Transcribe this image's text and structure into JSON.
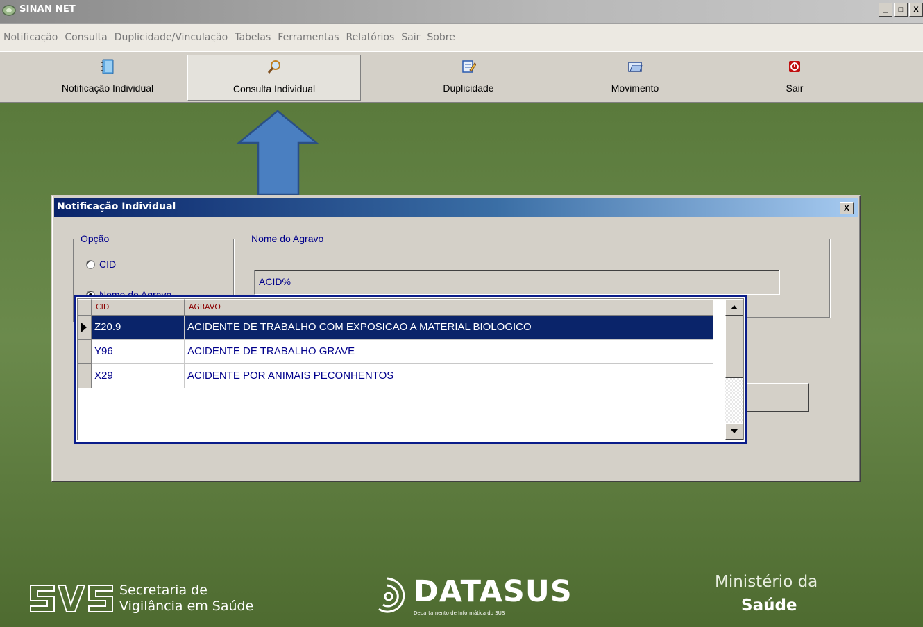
{
  "window": {
    "title": "SINAN NET",
    "controls": [
      "_",
      "□",
      "X"
    ]
  },
  "menu": {
    "items": [
      "Notificação",
      "Consulta",
      "Duplicidade/Vinculação",
      "Tabelas",
      "Ferramentas",
      "Relatórios",
      "Sair",
      "Sobre"
    ]
  },
  "toolbar": {
    "buttons": [
      {
        "label": "Notificação Individual",
        "icon": "notebook-icon"
      },
      {
        "label": "Consulta Individual",
        "icon": "magnifier-icon",
        "active": true
      },
      {
        "label": "Duplicidade",
        "icon": "duplicate-edit-icon"
      },
      {
        "label": "Movimento",
        "icon": "folder-icon"
      },
      {
        "label": "Sair",
        "icon": "power-icon"
      }
    ]
  },
  "dialog": {
    "title": "Notificação Individual",
    "close": "X",
    "option_group": {
      "title": "Opção",
      "options": [
        {
          "label": "CID",
          "checked": false
        },
        {
          "label": "Nome do Agravo",
          "checked": true
        }
      ]
    },
    "agravo_group": {
      "title": "Nome do Agravo",
      "value": "ACID%"
    }
  },
  "grid": {
    "columns": [
      "CID",
      "AGRAVO"
    ],
    "rows": [
      {
        "cid": "Z20.9",
        "agravo": "ACIDENTE DE TRABALHO COM EXPOSICAO A MATERIAL BIOLOGICO",
        "selected": true
      },
      {
        "cid": "Y96",
        "agravo": "ACIDENTE DE TRABALHO GRAVE",
        "selected": false
      },
      {
        "cid": "X29",
        "agravo": "ACIDENTE POR ANIMAIS PECONHENTOS",
        "selected": false
      }
    ]
  },
  "footer": {
    "svs_line1": "Secretaria de",
    "svs_line2": "Vigilância em Saúde",
    "datasus_title": "DATASUS",
    "datasus_subtitle": "Departamento de Informática do SUS",
    "ministerio_line1": "Ministério da",
    "ministerio_line2": "Saúde"
  },
  "colors": {
    "desktop": "#5a7a3c",
    "title_gradient_start": "#0a246a",
    "selection": "#0a246a",
    "grid_border": "#0a1c8a",
    "arrow_fill": "#4a7fc1"
  }
}
